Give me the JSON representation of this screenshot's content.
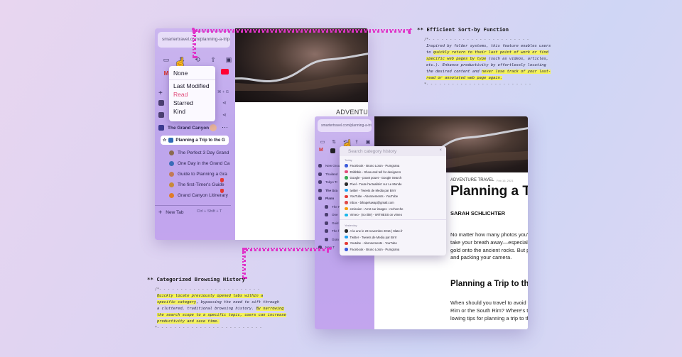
{
  "left_window": {
    "url": "smartertravel.com/planning-a-trip-t",
    "sort_menu": {
      "options": [
        "None",
        "Last Modified",
        "Read",
        "Starred",
        "Kind"
      ],
      "active": "Read"
    },
    "tab_group": {
      "label": "The Grand Canyon"
    },
    "active_tab": "Planning a Trip to the G",
    "tabs": [
      "The Perfect 3 Day Grand",
      "One Day in the Grand Ca",
      "Guide to Planning a Gra",
      "The first-Timer's Guide",
      "Grand Canyon Litinerary"
    ],
    "new_tab": {
      "label": "New Tab",
      "shortcut": "Ctrl + Shift + T"
    },
    "shortcut_hint": "⌘ + G",
    "article_category": "ADVENTURE"
  },
  "right_window": {
    "url": "smartertravel.com/planning-a-trip-t",
    "search_placeholder": "Search category history",
    "sections": {
      "today": "Today",
      "yesterday": "Yesterday"
    },
    "today_items": [
      {
        "text": "Facebook - Bruno Loton - Pumgrana",
        "color": "#3b5bdb"
      },
      {
        "text": "Dribbble - Show and tell for designers",
        "color": "#e04a7a"
      },
      {
        "text": "Google - pouet pouet - Google Search",
        "color": "#34a853"
      },
      {
        "text": "Pixel - Toute l'actualités' sur Le Monde",
        "color": "#2b2b2b"
      },
      {
        "text": "twitter - Tweets de Media par Brrrr",
        "color": "#1da1f2"
      },
      {
        "text": "YouTube - Abonnements - YouTube",
        "color": "#e53935"
      },
      {
        "text": "inbox - bihapeluwap@gmail.com",
        "color": "#e04a4a"
      },
      {
        "text": "emission - Arret sur images - recherche",
        "color": "#f59e0b"
      },
      {
        "text": "Vimeo - (no title) - WITNESS on vimeo",
        "color": "#1ab7ea"
      }
    ],
    "yesterday_items": [
      {
        "text": "A la une le 23 novembre 2016 | Slate.fr",
        "color": "#2b2b2b"
      },
      {
        "text": "Twitter - Tweets de Media par Brrrr",
        "color": "#1da1f2"
      },
      {
        "text": "Youtube - Abonnements - YouTube",
        "color": "#e53935"
      },
      {
        "text": "Facebook - Bruno Loton - Pumgrana",
        "color": "#3b5bdb"
      }
    ],
    "sidebar_items": [
      "New Grou",
      "Thailand",
      "Tokyo Tr",
      "The Gra",
      "Plann",
      "The P",
      "One",
      "Guid",
      "The f",
      "Gran",
      "New T"
    ],
    "article": {
      "category": "ADVENTURE TRAVEL",
      "date": "Feb 16, 2021",
      "title": "Planning a T",
      "author": "SARAH SCHLICHTER",
      "para1": [
        "No matter how many photos you've",
        "take your breath away—especially",
        "gold onto the ancient rocks. But pl",
        "and packing your camera."
      ],
      "subtitle": "Planning a Trip to th",
      "para2": [
        "When should you travel to avoid th",
        "Rim or the South Rim? Where's the",
        "lowing tips for planning a trip to the"
      ]
    }
  },
  "annotations": {
    "sort": {
      "title": "** Efficient Sort-by Function",
      "lines": [
        {
          "segments": [
            {
              "t": "Inspired by folder systems, this feature enables users",
              "hl": false
            }
          ]
        },
        {
          "segments": [
            {
              "t": "to ",
              "hl": false
            },
            {
              "t": "quickly return to their last point of work or find",
              "hl": true
            }
          ]
        },
        {
          "segments": [
            {
              "t": "specific web pages by type",
              "hl": true
            },
            {
              "t": " (such as videos, articles,",
              "hl": false
            }
          ]
        },
        {
          "segments": [
            {
              "t": "etc.). Enhance productivity by effortlessly locating",
              "hl": false
            }
          ]
        },
        {
          "segments": [
            {
              "t": "the desired content and ",
              "hl": false
            },
            {
              "t": "never lose track of your last-",
              "hl": true
            }
          ]
        },
        {
          "segments": [
            {
              "t": "read or annotated web page again.",
              "hl": true
            }
          ]
        }
      ]
    },
    "history": {
      "title": "** Categorized Browsing History",
      "lines": [
        {
          "segments": [
            {
              "t": "Quickly locate previously opened tabs within a",
              "hl": true
            }
          ]
        },
        {
          "segments": [
            {
              "t": "specific category",
              "hl": true
            },
            {
              "t": ", bypassing the need to sift through",
              "hl": false
            }
          ]
        },
        {
          "segments": [
            {
              "t": "a cluttered, traditional browsing history. ",
              "hl": false
            },
            {
              "t": "By narrowing",
              "hl": true
            }
          ]
        },
        {
          "segments": [
            {
              "t": "the search scope to a specific topic, users can increase",
              "hl": true
            }
          ]
        },
        {
          "segments": [
            {
              "t": "productivity and save time.",
              "hl": true
            }
          ]
        }
      ]
    }
  },
  "colors": {
    "accent": "#e033c8",
    "highlight": "#f4f25a",
    "active_sort": "#e04a7a"
  }
}
